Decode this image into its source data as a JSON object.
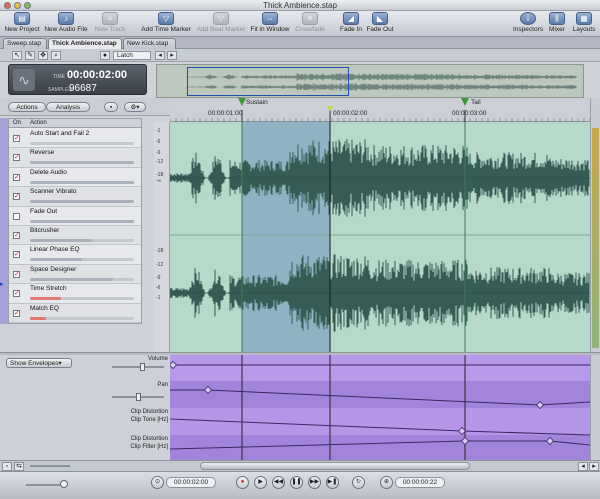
{
  "window": {
    "title": "Thick Ambience.stap"
  },
  "toolbar": {
    "items": [
      {
        "label": "New Project",
        "icon": "new-project-icon",
        "enabled": true
      },
      {
        "label": "New Audio File",
        "icon": "new-audio-file-icon",
        "enabled": true
      },
      {
        "label": "New Track",
        "icon": "new-track-icon",
        "enabled": false
      },
      {
        "label": "Add Time Marker",
        "icon": "add-time-marker-icon",
        "enabled": true
      },
      {
        "label": "Add Beat Marker",
        "icon": "add-beat-marker-icon",
        "enabled": false
      },
      {
        "label": "Fit in Window",
        "icon": "fit-in-window-icon",
        "enabled": true
      },
      {
        "label": "Crossfade",
        "icon": "crossfade-icon",
        "enabled": false
      },
      {
        "label": "Fade In",
        "icon": "fade-in-icon",
        "enabled": true
      },
      {
        "label": "Fade Out",
        "icon": "fade-out-icon",
        "enabled": true
      },
      {
        "label": "Inspectors",
        "icon": "inspectors-icon",
        "enabled": true
      },
      {
        "label": "Mixer",
        "icon": "mixer-icon",
        "enabled": true
      },
      {
        "label": "Layouts",
        "icon": "layouts-icon",
        "enabled": true
      }
    ]
  },
  "tabs": [
    {
      "label": "Sweep.stap",
      "active": false
    },
    {
      "label": "Thick Ambience.stap",
      "active": true
    },
    {
      "label": "New Kick.stap",
      "active": false
    }
  ],
  "tools": {
    "latch": "Latch"
  },
  "display": {
    "timecode": "00:00:02:00",
    "time_label": "TIME",
    "samples_label": "SAMPLES",
    "samples": "96687"
  },
  "actions_tabs": {
    "actions": "Actions",
    "analysis": "Analysis"
  },
  "actions_header": {
    "on": "On",
    "action": "Action"
  },
  "actions": [
    {
      "label": "Auto Start and Fail 2",
      "on": true,
      "slider": "gray",
      "level": 0.0
    },
    {
      "label": "Reverse",
      "on": true,
      "slider": "gray",
      "level": 1.0
    },
    {
      "label": "Delete Audio",
      "on": true,
      "slider": "gray",
      "level": 1.0
    },
    {
      "label": "Scanner Vibrato",
      "on": true,
      "slider": "gray",
      "level": 1.0
    },
    {
      "label": "Fade Out",
      "on": false,
      "slider": "gray",
      "level": 1.0
    },
    {
      "label": "Bitcrusher",
      "on": true,
      "slider": "gray",
      "level": 0.6
    },
    {
      "label": "Linear Phase EQ",
      "on": true,
      "slider": "gray",
      "level": 0.5
    },
    {
      "label": "Space Designer",
      "on": true,
      "slider": "gray",
      "level": 0.8
    },
    {
      "label": "Time Stretch",
      "on": true,
      "slider": "red",
      "level": 0.3
    },
    {
      "label": "Match EQ",
      "on": true,
      "slider": "red",
      "level": 0.15
    }
  ],
  "ruler": {
    "ticks": [
      "00:00:01:00",
      "00:00:02:00",
      "00:00:03:00"
    ],
    "markers": [
      "Sustain",
      "Tail"
    ]
  },
  "vruler": {
    "labels": [
      "-1",
      "-6",
      "-9",
      "-12",
      "-18",
      "-∞",
      "-18",
      "-12",
      "-9",
      "-6",
      "-1"
    ]
  },
  "envelopes": {
    "menu": "Show Envelopes",
    "rows": [
      {
        "label": "Volume",
        "unit": ""
      },
      {
        "label": "Pan",
        "unit": ""
      },
      {
        "label": "Clip Distortion",
        "unit": "Clip Tone [Hz]"
      },
      {
        "label": "Clip Distortion",
        "unit": "Clip Filter [Hz]"
      }
    ]
  },
  "transport": {
    "left_time": "00:00:02:00",
    "right_time": "00:00:00:22"
  },
  "colors": {
    "waveform_bg": "#b6d9c9",
    "waveform": "#365c55",
    "selection": "#4d7f93",
    "envelope_bg": "#ad8ee4",
    "cursor": "#1a1a1a"
  }
}
